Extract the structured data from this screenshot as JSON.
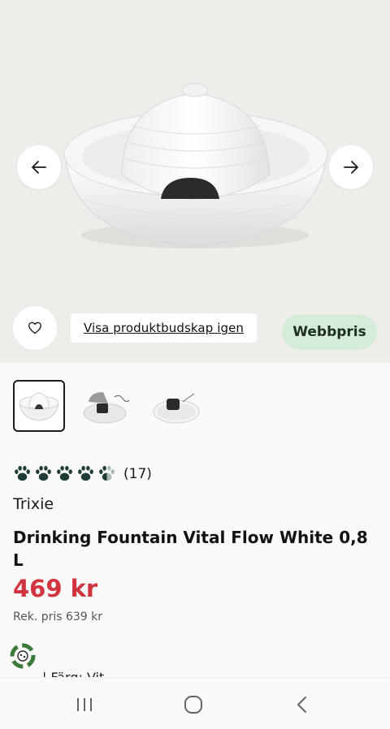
{
  "gallery": {
    "prev_icon": "arrow-left-icon",
    "next_icon": "arrow-right-icon",
    "thumbnails": [
      "fountain-front",
      "fountain-hand-filter",
      "fountain-top-pump"
    ],
    "active_index": 0
  },
  "actions": {
    "favorite_icon": "heart-outline-icon",
    "show_message_label": "Visa produktbudskap igen",
    "web_price_label": "Webbpris"
  },
  "product": {
    "rating_value": 4.5,
    "rating_max": 5,
    "rating_count": "(17)",
    "brand": "Trixie",
    "title": "Drinking Fountain Vital Flow White 0,8 L",
    "price": "469 kr",
    "rek_price": "Rek. pris 639 kr",
    "color_label": "| Färg: Vit"
  },
  "colors": {
    "price": "#d1333f",
    "paw": "#1f3d38",
    "webbpris_bg": "#d5ecd9"
  },
  "system_nav": {
    "recents_icon": "recents-icon",
    "home_icon": "home-icon",
    "back_icon": "back-chevron-icon"
  }
}
